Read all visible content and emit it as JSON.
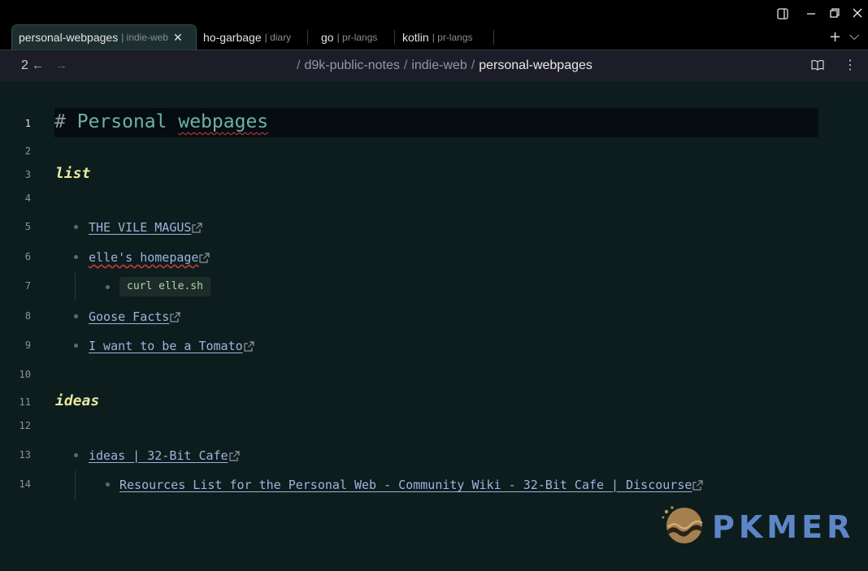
{
  "tabs": [
    {
      "title": "personal-webpages",
      "subtitle": "| indie-web",
      "close": "✕"
    },
    {
      "title": "ho-garbage",
      "subtitle": "| diary"
    },
    {
      "title": "go",
      "subtitle": "| pr-langs"
    },
    {
      "title": "kotlin",
      "subtitle": "| pr-langs"
    }
  ],
  "tabbar": {
    "new_tab": "+",
    "tab_list": "⌵"
  },
  "window_controls": {
    "sidebar": "▢",
    "minimize": "—",
    "restore": "❐",
    "close": "✕"
  },
  "header": {
    "history_count": "2",
    "back": "←",
    "forward": "→",
    "breadcrumb": {
      "sep": "/",
      "items": [
        "d9k-public-notes",
        "indie-web"
      ],
      "current": "personal-webpages"
    },
    "reading_view": "📖",
    "more_options": "⋮"
  },
  "editor": {
    "line_numbers": [
      "1",
      "2",
      "3",
      "4",
      "5",
      "6",
      "7",
      "8",
      "9",
      "10",
      "11",
      "12",
      "13",
      "14"
    ],
    "active_line": "1",
    "h1": {
      "hash": "#",
      "word1": "Personal",
      "word2": "webpages"
    },
    "section_list": "list",
    "links": {
      "vile": "THE VILE MAGUS",
      "elle": "elle's homepage",
      "goose": "Goose Facts",
      "tomato": "I want to be a Tomato",
      "ideas": "ideas | 32-Bit Cafe",
      "resources": "Resources List for the Personal Web - Community Wiki - 32-Bit Cafe | Discourse"
    },
    "code": "curl elle.sh",
    "section_ideas": "ideas"
  },
  "watermark": {
    "text": "PKMER"
  }
}
